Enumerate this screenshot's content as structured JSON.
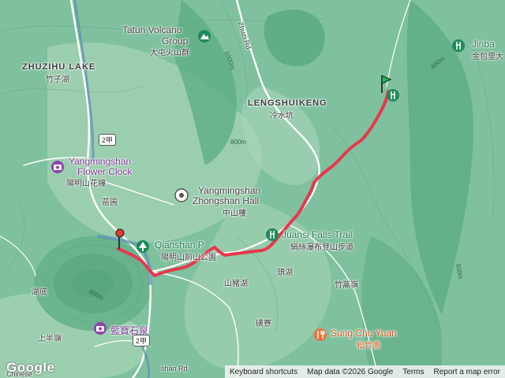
{
  "map": {
    "attribution": {
      "keyboard_shortcuts": "Keyboard shortcuts",
      "map_data": "Map data ©2026 Google",
      "terms": "Terms",
      "report": "Report a map error"
    },
    "logo": "Google",
    "labels": {
      "tatun": "Tatun Volcano",
      "tatun2": "Group",
      "tatun_zh": "大屯火山群",
      "zhuzihu": "ZHUZIHU LAKE",
      "zhuzihu_zh": "竹子湖",
      "lengshuikeng": "LENGSHUIKENG",
      "lengshuikeng_zh": "冷水坑",
      "jinbao": "Jinba",
      "jinbao_zh": "金包里大",
      "flower_clock": "Yangmingshan",
      "flower_clock2": "Flower Clock",
      "flower_clock_zh": "陽明山花鐘",
      "zhongshan": "Yangmingshan",
      "zhongshan2": "Zhongshan Hall",
      "zhongshan_zh": "中山樓",
      "miaopu": "苗圃",
      "qianshan": "Qianshan P",
      "qianshan_zh": "陽明山前山公園",
      "juansi": "Juansi Falls Trail",
      "juansi_zh": "絹絲瀑布登山步道",
      "touhu": "頭湖",
      "shanzhuhu": "山豬湖",
      "zhuhaoling": "竹蒿嶺",
      "kuangliao": "磺寮",
      "hudi": "湖底",
      "shangbanling": "上半嶺",
      "lanbao": "藍寶石泉",
      "sungchu": "Sung Chu Yuan",
      "sungchu_zh": "松竹園",
      "zhuzi_rd": "Zhuzi Rd",
      "road_2jia_a": "2甲",
      "road_2jia_b": "2甲",
      "han_rd": "shan Rd",
      "chinese": "Chinese",
      "c800": "800m",
      "c1000": "1000m",
      "c600a": "600m",
      "c600b": "600m",
      "c500": "500m"
    },
    "colors": {
      "terrain": "#7fc19e",
      "route": "#e8374d",
      "park_icon": "#1f8a5a"
    }
  }
}
